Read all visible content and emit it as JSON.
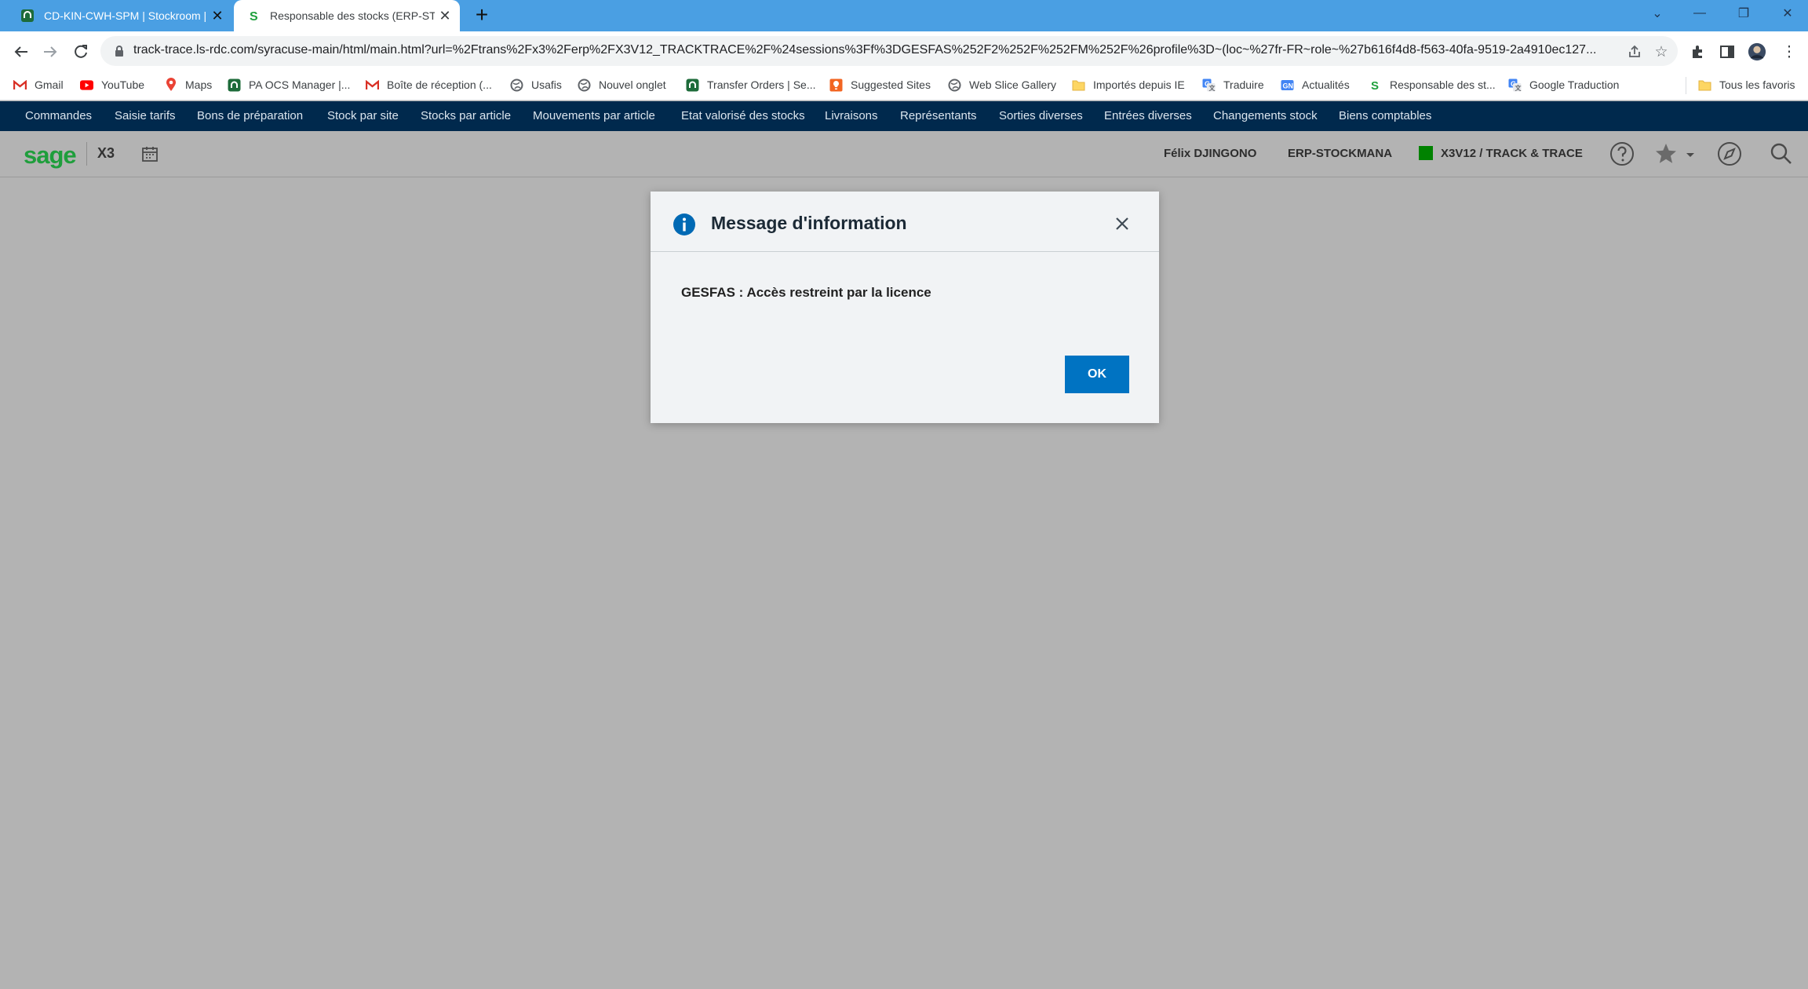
{
  "browser": {
    "tabs": [
      {
        "title": "CD-KIN-CWH-SPM | Stockroom |",
        "icon": "ocs-green-icon",
        "active": false
      },
      {
        "title": "Responsable des stocks (ERP-STC",
        "icon": "sage-s-icon",
        "active": true
      }
    ],
    "new_tab_label": "+",
    "url": "track-trace.ls-rdc.com/syracuse-main/html/main.html?url=%2Ftrans%2Fx3%2Ferp%2FX3V12_TRACKTRACE%2F%24sessions%3Ff%3DGESFAS%252F2%252F%252FM%252F%26profile%3D~(loc~%27fr-FR~role~%27b616f4d8-f563-40fa-9519-2a4910ec127...",
    "bookmarks": [
      {
        "label": "Gmail",
        "icon": "gmail-icon"
      },
      {
        "label": "YouTube",
        "icon": "youtube-icon"
      },
      {
        "label": "Maps",
        "icon": "maps-pin-icon"
      },
      {
        "label": "PA OCS Manager |...",
        "icon": "ocs-icon"
      },
      {
        "label": "Boîte de réception (...",
        "icon": "gmail-icon"
      },
      {
        "label": "Usafis",
        "icon": "globe-icon"
      },
      {
        "label": "Nouvel onglet",
        "icon": "globe-icon"
      },
      {
        "label": "Transfer Orders | Se...",
        "icon": "ocs-icon"
      },
      {
        "label": "Suggested Sites",
        "icon": "suggested-sites-icon"
      },
      {
        "label": "Web Slice Gallery",
        "icon": "globe-icon"
      },
      {
        "label": "Importés depuis IE",
        "icon": "folder-icon"
      },
      {
        "label": "Traduire",
        "icon": "translate-icon"
      },
      {
        "label": "Actualités",
        "icon": "news-icon"
      },
      {
        "label": "Responsable des st...",
        "icon": "sage-s-icon"
      },
      {
        "label": "Google Traduction",
        "icon": "translate-icon"
      }
    ],
    "other_bookmarks": "Tous les favoris"
  },
  "sage_menu": [
    "Commandes",
    "Saisie tarifs",
    "Bons de préparation",
    "Stock par site",
    "Stocks par article",
    "Mouvements par article",
    "Etat valorisé des stocks",
    "Livraisons",
    "Représentants",
    "Sorties diverses",
    "Entrées diverses",
    "Changements stock",
    "Biens comptables"
  ],
  "header": {
    "logo": "sage",
    "product": "X3",
    "user": "Félix DJINGONO",
    "role": "ERP-STOCKMANA",
    "folder": "X3V12 / TRACK & TRACE",
    "folder_color": "#008200"
  },
  "dialog": {
    "title": "Message d'information",
    "message": "GESFAS : Accès restreint par la licence",
    "ok_label": "OK"
  },
  "colors": {
    "tab_strip": "#4a9fe3",
    "sage_menu_bg": "#00294d",
    "sage_green": "#1f9e3c",
    "ok_button": "#0073c2",
    "info_icon": "#0069b4"
  }
}
